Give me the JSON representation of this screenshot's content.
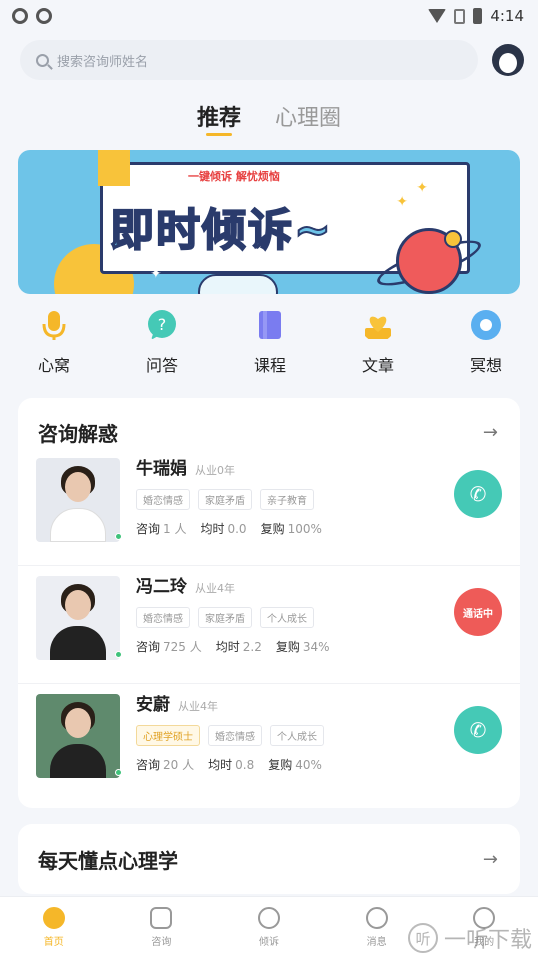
{
  "status_bar": {
    "time": "4:14"
  },
  "search": {
    "placeholder": "搜索咨询师姓名"
  },
  "tabs": [
    {
      "label": "推荐",
      "active": true
    },
    {
      "label": "心理圈",
      "active": false
    }
  ],
  "banner": {
    "subtitle": "一键倾诉 解忧烦恼",
    "title": "即时倾诉~"
  },
  "quick_nav": [
    {
      "label": "心窝",
      "icon": "microphone-icon",
      "color": "#f5b729"
    },
    {
      "label": "问答",
      "icon": "question-bubble-icon",
      "color": "#45c9b6"
    },
    {
      "label": "课程",
      "icon": "book-icon",
      "color": "#7a7cf0"
    },
    {
      "label": "文章",
      "icon": "heart-card-icon",
      "color": "#f5b729"
    },
    {
      "label": "冥想",
      "icon": "meditation-circle-icon",
      "color": "#5aaff0"
    }
  ],
  "consult_section": {
    "title": "咨询解惑",
    "counselors": [
      {
        "name": "牛瑞娟",
        "years": "从业0年",
        "tags": [
          "婚恋情感",
          "家庭矛盾",
          "亲子教育"
        ],
        "consults_label": "咨询",
        "consults": "1 人",
        "avg_label": "均时",
        "avg": "0.0",
        "repeat_label": "复购",
        "repeat": "100%",
        "call": "phone",
        "photo_bg": "#e6e9ef",
        "outfit": "#ffffff"
      },
      {
        "name": "冯二玲",
        "years": "从业4年",
        "tags": [
          "婚恋情感",
          "家庭矛盾",
          "个人成长"
        ],
        "consults_label": "咨询",
        "consults": "725 人",
        "avg_label": "均时",
        "avg": "2.2",
        "repeat_label": "复购",
        "repeat": "34%",
        "call": "busy",
        "call_text": "通话中",
        "photo_bg": "#eceef3",
        "outfit": "#222222"
      },
      {
        "name": "安蔚",
        "years": "从业4年",
        "tags": [
          "心理学硕士",
          "婚恋情感",
          "个人成长"
        ],
        "consults_label": "咨询",
        "consults": "20 人",
        "avg_label": "均时",
        "avg": "0.8",
        "repeat_label": "复购",
        "repeat": "40%",
        "call": "phone",
        "photo_bg": "#5f8a6d",
        "outfit": "#222222"
      }
    ]
  },
  "daily_section": {
    "title": "每天懂点心理学"
  },
  "bottom_nav": [
    {
      "label": "首页",
      "active": true
    },
    {
      "label": "咨询",
      "active": false
    },
    {
      "label": "倾诉",
      "active": false
    },
    {
      "label": "消息",
      "active": false
    },
    {
      "label": "我的",
      "active": false
    }
  ],
  "watermark": {
    "badge": "听",
    "text": "一听下载"
  },
  "colors": {
    "accent": "#f5b729",
    "call_green": "#45c9b6",
    "call_busy": "#ee5b58"
  }
}
